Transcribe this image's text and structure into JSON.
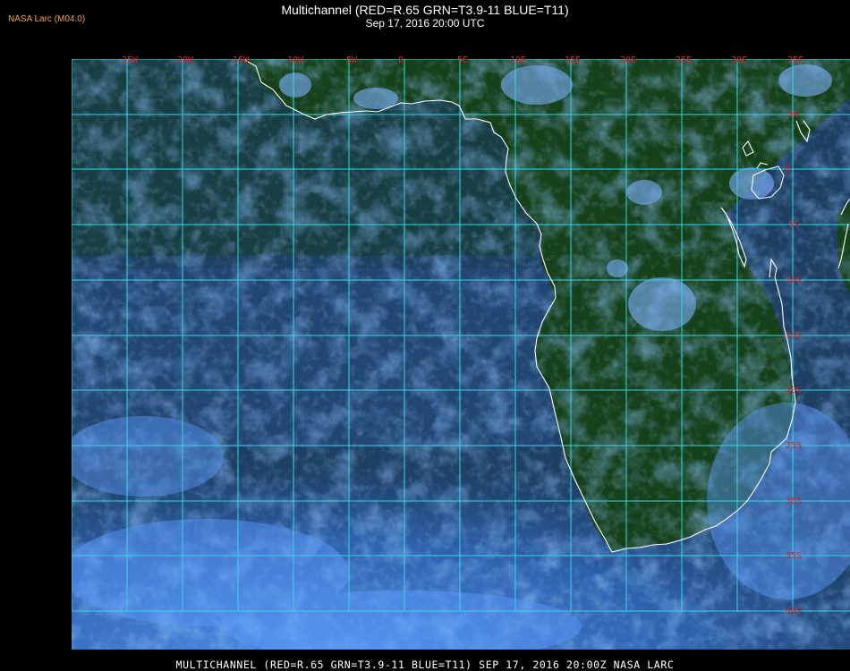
{
  "header": {
    "badge": "NASA Larc (M04.0)",
    "title": "Multichannel (RED=R.65 GRN=T3.9-11 BLUE=T11)",
    "subtitle": "Sep 17, 2016 20:00 UTC"
  },
  "footer": {
    "caption": "MULTICHANNEL (RED=R.65 GRN=T3.9-11 BLUE=T11) SEP 17, 2016 20:00Z   NASA LARC"
  },
  "colors": {
    "background": "#000000",
    "land": "#163d16",
    "ocean": "#1e3f6e",
    "cloud": "#3f86f2",
    "bright_cloud": "#85b8ff",
    "grid": "#33d6e6",
    "label": "#d8252a",
    "coast": "#ffffff"
  },
  "map": {
    "longitude_labels": [
      "25W",
      "20W",
      "15W",
      "10W",
      "5W",
      "0",
      "5E",
      "10E",
      "15E",
      "20E",
      "25E",
      "30E",
      "35E"
    ],
    "latitude_labels": [
      "5N",
      "0",
      "5S",
      "10S",
      "15S",
      "20S",
      "25S",
      "30S",
      "35S",
      "40S"
    ]
  }
}
